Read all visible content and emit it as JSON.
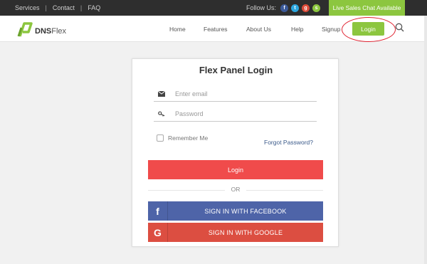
{
  "topbar": {
    "links": [
      "Services",
      "Contact",
      "FAQ"
    ],
    "follow_label": "Follow Us:",
    "social_icons": [
      "facebook-icon",
      "twitter-icon",
      "google-plus-icon",
      "skype-icon"
    ],
    "live_chat": "Live Sales Chat Available"
  },
  "header": {
    "logo_text_bold": "DNS",
    "logo_text_light": "Flex",
    "nav": [
      "Home",
      "Features",
      "About Us",
      "Help",
      "Signup"
    ],
    "login_button": "Login"
  },
  "login": {
    "title": "Flex Panel Login",
    "email_placeholder": "Enter email",
    "password_placeholder": "Password",
    "remember": "Remember Me",
    "forgot": "Forgot Password?",
    "submit": "Login",
    "or": "OR",
    "facebook": "SIGN IN WITH FACEBOOK",
    "google": "SIGN IN WITH GOOGLE"
  },
  "colors": {
    "accent_green": "#8cc63f",
    "login_red": "#f04b4b",
    "facebook_blue": "#4e64a8",
    "google_red": "#dc4e41"
  }
}
